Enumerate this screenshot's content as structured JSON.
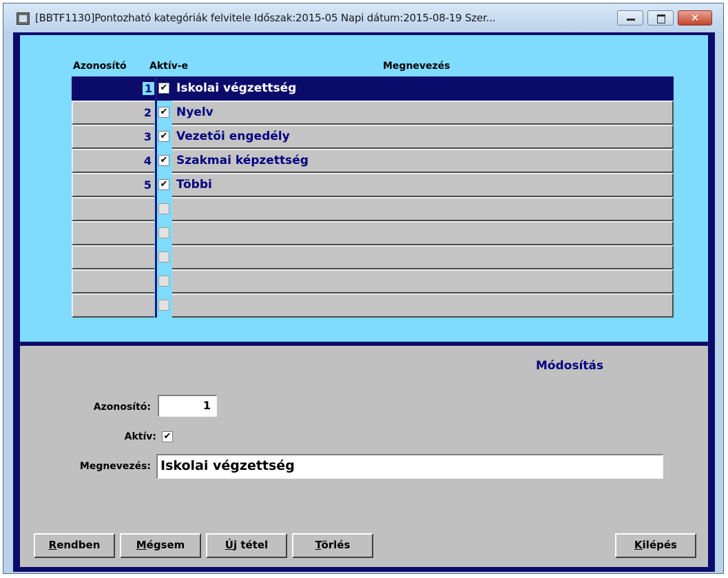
{
  "window": {
    "title": "[BBTF1130]Pontozható kategóriák felvitele Időszak:2015-05 Napi dátum:2015-08-19 Szer...",
    "close_glyph": "✕"
  },
  "list": {
    "headers": {
      "id": "Azonosító",
      "active": "Aktív-e",
      "name": "Megnevezés"
    },
    "rows": [
      {
        "id": "1",
        "active": true,
        "name": "Iskolai végzettség"
      },
      {
        "id": "2",
        "active": true,
        "name": "Nyelv"
      },
      {
        "id": "3",
        "active": true,
        "name": "Vezetői engedély"
      },
      {
        "id": "4",
        "active": true,
        "name": "Szakmai képzettség"
      },
      {
        "id": "5",
        "active": true,
        "name": "Többi"
      },
      {
        "id": "",
        "active": false,
        "name": ""
      },
      {
        "id": "",
        "active": false,
        "name": ""
      },
      {
        "id": "",
        "active": false,
        "name": ""
      },
      {
        "id": "",
        "active": false,
        "name": ""
      },
      {
        "id": "",
        "active": false,
        "name": ""
      }
    ],
    "selected_index": 0
  },
  "form": {
    "mode": "Módosítás",
    "id_label": "Azonosító:",
    "id_value": "1",
    "active_label": "Aktív:",
    "active_value": true,
    "name_label": "Megnevezés:",
    "name_value": "Iskolai végzettség",
    "check_glyph": "✔"
  },
  "buttons": {
    "ok": {
      "accel": "R",
      "rest": "endben"
    },
    "cancel": {
      "accel": "M",
      "rest": "égsem"
    },
    "new": {
      "accel": "Ú",
      "rest": "j tétel"
    },
    "delete_pre": "T",
    "delete": {
      "accel": "ö",
      "rest": "rlés"
    },
    "exit": {
      "accel": "K",
      "rest": "ilépés"
    }
  }
}
